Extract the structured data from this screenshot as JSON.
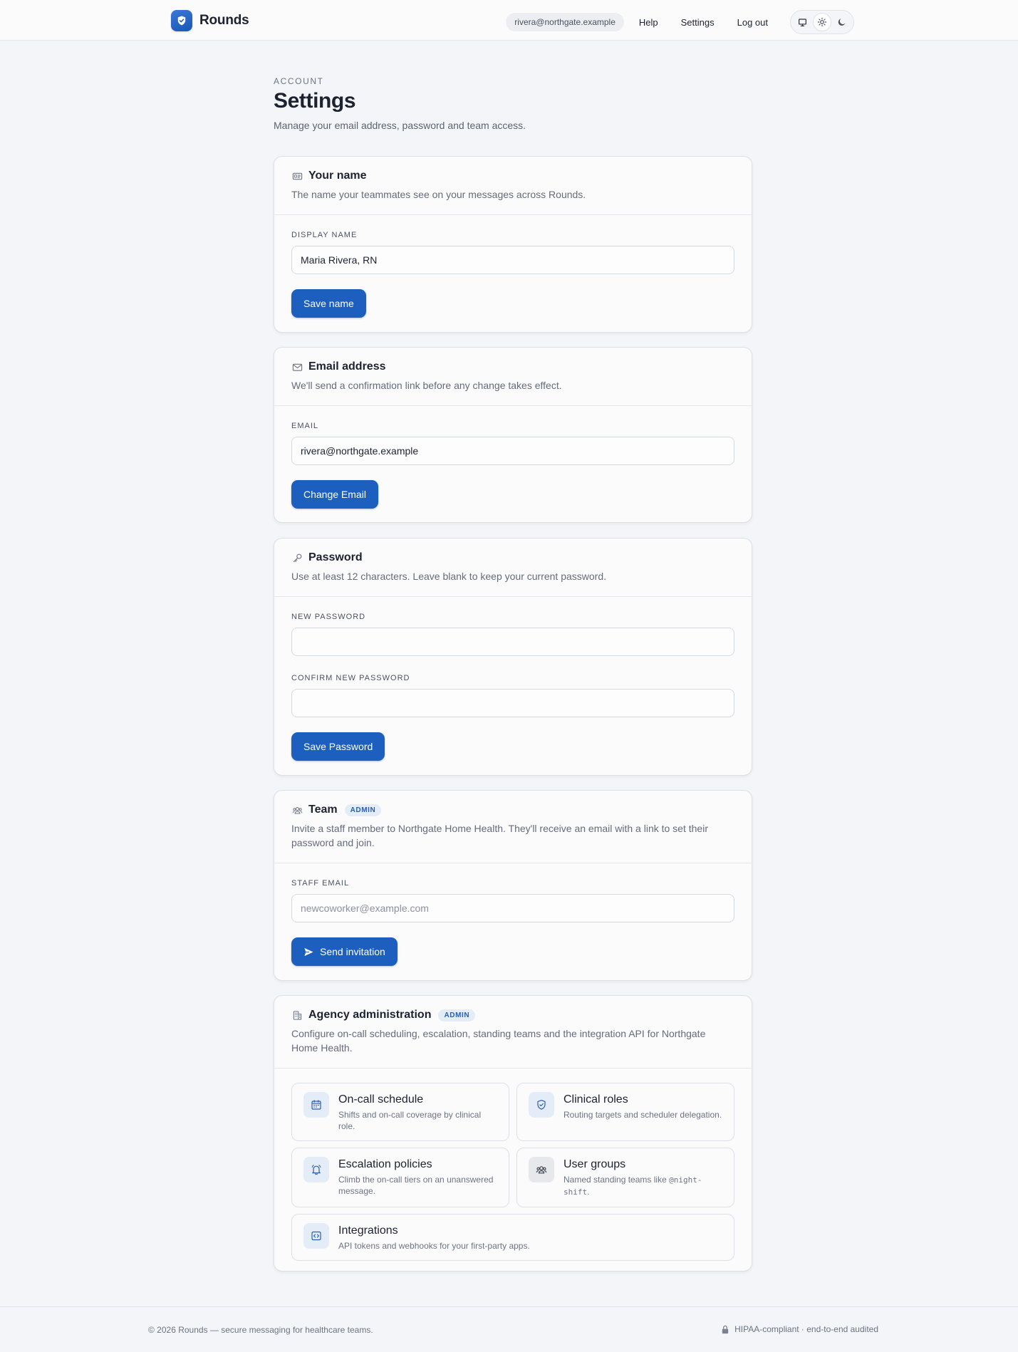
{
  "nav": {
    "brand": "Rounds",
    "user_email": "rivera@northgate.example",
    "links": {
      "help": "Help",
      "settings": "Settings",
      "logout": "Log out"
    },
    "theme_options": [
      "monitor-icon",
      "sun-icon",
      "moon-icon"
    ],
    "active_theme": "sun-icon"
  },
  "header": {
    "eyebrow": "ACCOUNT",
    "title": "Settings",
    "subtitle": "Manage your email address, password and team access."
  },
  "name_card": {
    "title": "Your name",
    "description": "The name your teammates see on your messages across Rounds.",
    "label": "DISPLAY NAME",
    "value": "Maria Rivera, RN",
    "button": "Save name"
  },
  "email_card": {
    "title": "Email address",
    "description": "We'll send a confirmation link before any change takes effect.",
    "label": "EMAIL",
    "value": "rivera@northgate.example",
    "button": "Change Email"
  },
  "password_card": {
    "title": "Password",
    "description": "Use at least 12 characters. Leave blank to keep your current password.",
    "new_label": "NEW PASSWORD",
    "confirm_label": "CONFIRM NEW PASSWORD",
    "button": "Save Password"
  },
  "team_card": {
    "title": "Team",
    "badge": "ADMIN",
    "description": "Invite a staff member to Northgate Home Health. They'll receive an email with a link to set their password and join.",
    "label": "STAFF EMAIL",
    "placeholder": "newcoworker@example.com",
    "button": "Send invitation"
  },
  "admin_card": {
    "title": "Agency administration",
    "badge": "ADMIN",
    "description": "Configure on-call scheduling, escalation, standing teams and the integration API for Northgate Home Health.",
    "tiles": [
      {
        "title": "On-call schedule",
        "description": "Shifts and on-call coverage by clinical role.",
        "icon": "calendar-icon"
      },
      {
        "title": "Clinical roles",
        "description": "Routing targets and scheduler delegation.",
        "icon": "shield-check-icon"
      },
      {
        "title": "Escalation policies",
        "description": "Climb the on-call tiers on an unanswered message.",
        "icon": "bell-icon"
      },
      {
        "title": "User groups",
        "description_prefix": "Named standing teams like ",
        "description_code": "@night-shift",
        "description_suffix": ".",
        "icon": "users-icon"
      },
      {
        "title": "Integrations",
        "description": "API tokens and webhooks for your first-party apps.",
        "icon": "code-icon"
      }
    ]
  },
  "footer": {
    "left": "© 2026 Rounds — secure messaging for healthcare teams.",
    "right": "HIPAA-compliant · end-to-end audited"
  },
  "colors": {
    "accent": "#1d5fbf",
    "page_bg": "#f4f5f8",
    "badge_bg": "#e4ecf8"
  }
}
